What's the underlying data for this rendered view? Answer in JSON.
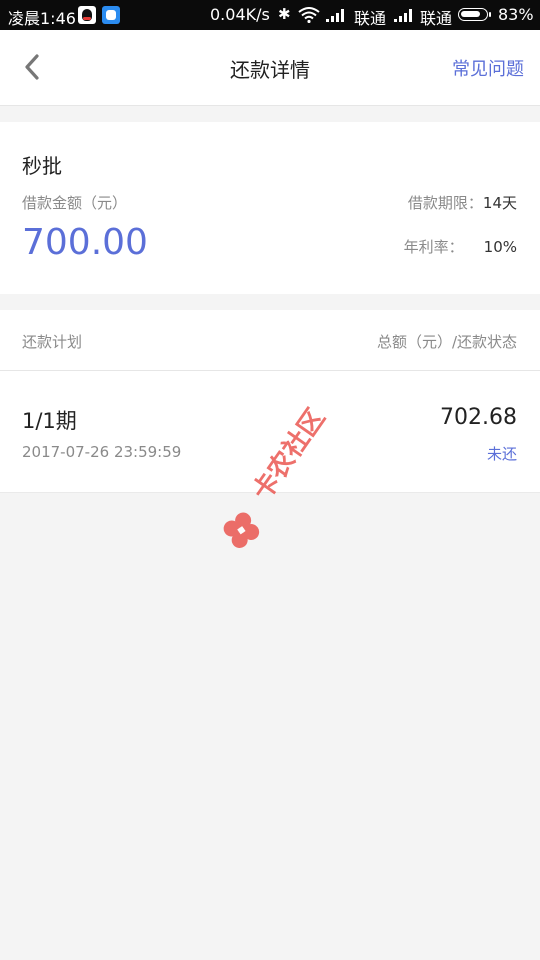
{
  "status_bar": {
    "time": "凌晨1:46",
    "net_speed": "0.04K/s",
    "carrier_1": "联通",
    "carrier_2": "联通",
    "battery_percent": "83%",
    "battery_level": 0.83,
    "icons": [
      "qq-icon",
      "app-icon",
      "bluetooth-icon",
      "wifi-icon",
      "signal-icon",
      "battery-icon"
    ]
  },
  "header": {
    "title": "还款详情",
    "faq_label": "常见问题"
  },
  "loan": {
    "product_name": "秒批",
    "amount_label": "借款金额（元）",
    "amount_value": "700.00",
    "term_label": "借款期限：",
    "term_value": "14天",
    "rate_label": "年利率：",
    "rate_value": "10%"
  },
  "plan": {
    "header_left": "还款计划",
    "header_right": "总额（元）/还款状态",
    "installments": [
      {
        "period": "1/1期",
        "due": "2017-07-26 23:59:59",
        "amount": "702.68",
        "status": "未还"
      }
    ]
  },
  "watermark": {
    "text": "卡农社区"
  },
  "colors": {
    "accent": "#5b6fd8",
    "watermark": "#e8413a",
    "background": "#f4f4f4"
  }
}
